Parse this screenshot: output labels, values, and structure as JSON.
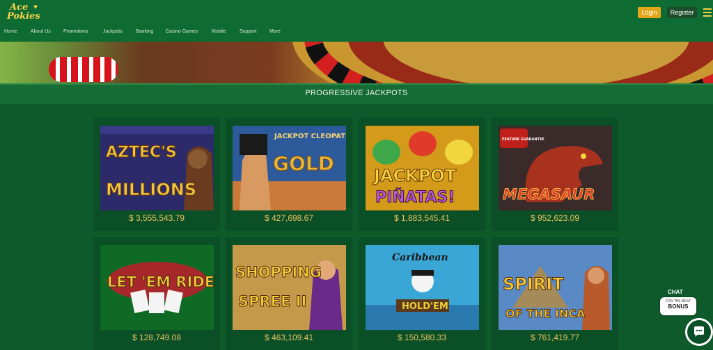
{
  "header": {
    "logo_line1": "Ace",
    "logo_line2": "Pokies",
    "login_label": "Login",
    "register_label": "Register",
    "menu_icon": "hamburger-menu-icon"
  },
  "nav": {
    "items": [
      "Home",
      "About Us",
      "Promotions",
      "Jackpots",
      "Banking",
      "Casino Games",
      "Mobile",
      "Support",
      "More"
    ]
  },
  "section": {
    "title": "PROGRESSIVE JACKPOTS"
  },
  "games": [
    {
      "title_line1": "AZTEC'S",
      "title_line2": "MILLIONS",
      "amount": "$ 3,555,543.79"
    },
    {
      "title_line1": "JACKPOT CLEOPATRA'S",
      "title_line2": "GOLD",
      "amount": "$ 427,698.67"
    },
    {
      "title_line1": "JACKPOT",
      "title_line2": "PIÑATAS!",
      "amount": "$ 1,883,545.41"
    },
    {
      "badge": "FEATURE GUARANTEE",
      "title_line1": "MEGASAUR",
      "amount": "$ 952,623.09"
    },
    {
      "title_line1": "LET 'EM RIDE",
      "amount": "$ 128,749.08"
    },
    {
      "title_line1": "SHOPPING",
      "title_line2": "SPREE II",
      "amount": "$ 463,109.41"
    },
    {
      "title_line1": "Caribbean",
      "title_line2": "HOLD'EM",
      "amount": "$ 150,580.33"
    },
    {
      "title_line1": "SPIRIT",
      "title_line2": "OF THE INCA",
      "amount": "$ 761,419.77"
    }
  ],
  "chat": {
    "label": "CHAT",
    "bubble_small": "FOR THE BEST",
    "bubble_big": "BONUS",
    "icon": "chat-bubble-icon"
  },
  "colors": {
    "background": "#0f5a2b",
    "header": "#0e6b32",
    "accent": "#f6d34a",
    "login_button": "#e4a71b",
    "amount_text": "#e6c261"
  }
}
